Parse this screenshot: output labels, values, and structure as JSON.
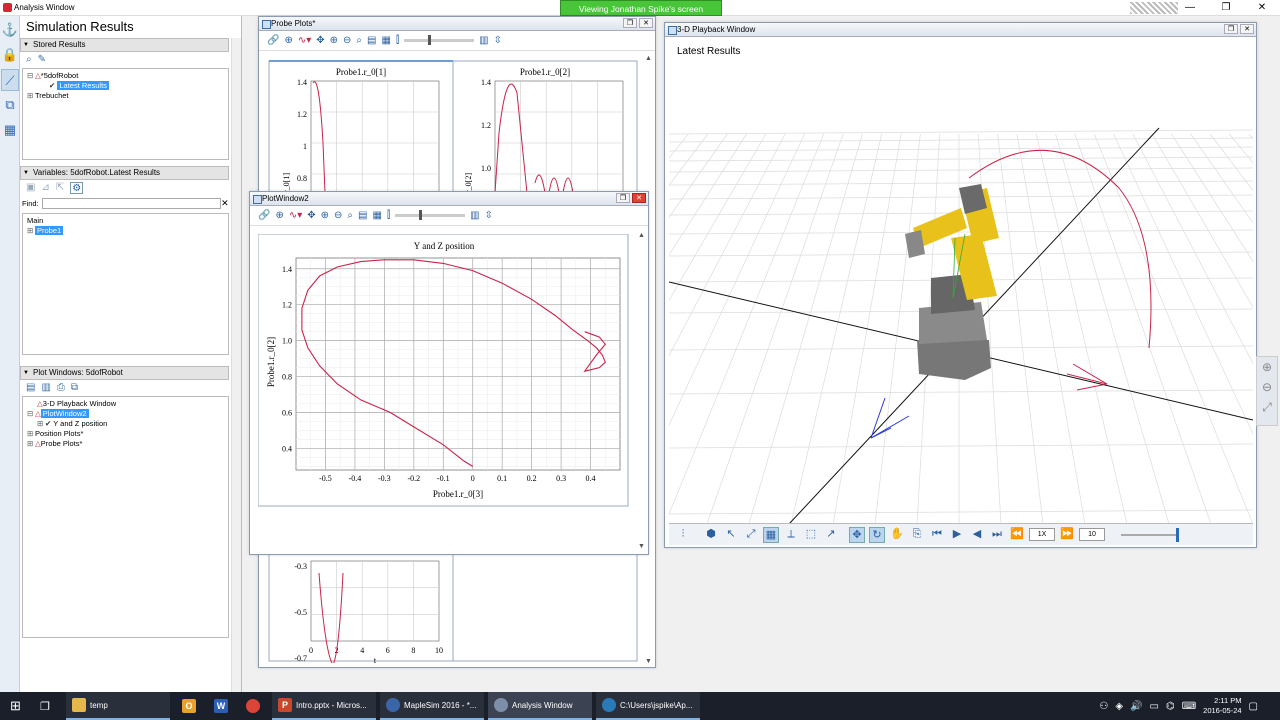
{
  "app": {
    "title": "Analysis Window",
    "share_banner": "Viewing Jonathan Spike's screen",
    "win_minimize": "—",
    "win_restore": "❐",
    "win_close": "✕"
  },
  "sim_panel": {
    "title": "Simulation Results",
    "stored_results": {
      "header": "Stored Results",
      "tree": [
        {
          "label": "*5dofRobot"
        },
        {
          "label": "Latest Results"
        },
        {
          "label": "Trebuchet"
        }
      ]
    },
    "variables": {
      "header": "Variables: 5dofRobot.Latest Results",
      "find_label": "Find:",
      "find_value": "",
      "tree": [
        {
          "label": "Main"
        },
        {
          "label": "Probe1"
        }
      ]
    },
    "plot_windows": {
      "header": "Plot Windows: 5dofRobot",
      "tree": [
        {
          "label": "3-D Playback Window"
        },
        {
          "label": "PlotWindow2"
        },
        {
          "label": "Y and Z position"
        },
        {
          "label": "Position Plots*"
        },
        {
          "label": "Probe Plots*"
        }
      ]
    }
  },
  "probe_plots": {
    "title": "Probe Plots*",
    "plot1": {
      "title": "Probe1.r_0[1]",
      "ylabel": "r_0[1]",
      "yticks": [
        "1.4",
        "1.2",
        "1",
        "0.8"
      ]
    },
    "plot2": {
      "title": "Probe1.r_0[2]",
      "ylabel": "r_0[2]",
      "yticks": [
        "1.4",
        "1.2",
        "1.0"
      ]
    },
    "plot_bottom": {
      "yticks": [
        "-0.3",
        "-0.5",
        "-0.7"
      ],
      "xticks": [
        "0",
        "2",
        "4",
        "6",
        "8",
        "10"
      ],
      "xlabel": "t"
    }
  },
  "plot_window2": {
    "title": "PlotWindow2",
    "chart_data": {
      "type": "line",
      "title": "Y and Z position",
      "xlabel": "Probe1.r_0[3]",
      "ylabel": "Probe1.r_0[2]",
      "xlim": [
        -0.6,
        0.5
      ],
      "ylim": [
        0.28,
        1.46
      ],
      "xticks": [
        "-0.5",
        "-0.4",
        "-0.3",
        "-0.2",
        "-0.1",
        "0",
        "0.1",
        "0.2",
        "0.3",
        "0.4"
      ],
      "yticks": [
        "1.4",
        "1.2",
        "1.0",
        "0.8",
        "0.6",
        "0.4"
      ],
      "grid": true,
      "series": [
        {
          "color": "#c8234a",
          "x": [
            0.0,
            -0.03,
            -0.1,
            -0.2,
            -0.28,
            -0.38,
            -0.46,
            -0.52,
            -0.56,
            -0.58,
            -0.58,
            -0.56,
            -0.52,
            -0.46,
            -0.38,
            -0.3,
            -0.2,
            -0.1,
            0.0,
            0.1,
            0.2,
            0.28,
            0.34,
            0.39,
            0.42,
            0.44,
            0.45,
            0.43,
            0.38,
            0.42,
            0.45,
            0.43,
            0.38
          ],
          "y": [
            0.3,
            0.33,
            0.42,
            0.52,
            0.6,
            0.67,
            0.76,
            0.86,
            0.96,
            1.06,
            1.18,
            1.28,
            1.36,
            1.41,
            1.44,
            1.45,
            1.45,
            1.43,
            1.39,
            1.32,
            1.23,
            1.14,
            1.06,
            1.0,
            0.96,
            0.92,
            0.88,
            0.85,
            0.83,
            0.92,
            0.98,
            1.02,
            1.05
          ]
        }
      ]
    }
  },
  "playback_3d": {
    "title": "3-D Playback Window",
    "view_label": "Latest Results",
    "speed_value": "1X",
    "step_value": "10"
  },
  "taskbar": {
    "items": [
      {
        "label": "temp"
      },
      {
        "label": "Intro.pptx - Micros..."
      },
      {
        "label": "MapleSim 2016 - *..."
      },
      {
        "label": "Analysis Window"
      },
      {
        "label": "C:\\Users\\jspike\\Ap..."
      }
    ],
    "time": "2:11 PM",
    "date": "2016-05-24"
  },
  "colors": {
    "accent": "#3399ff",
    "curve": "#c8234a",
    "banner": "#49c53a"
  }
}
